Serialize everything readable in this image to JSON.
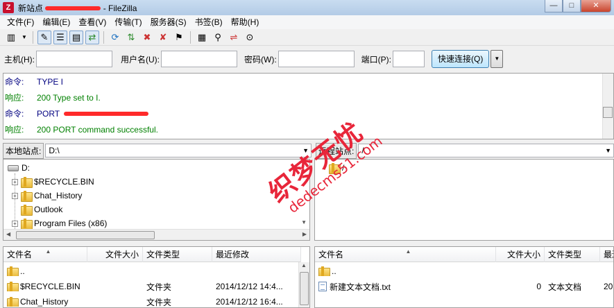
{
  "window": {
    "title": "新站点",
    "app": "FileZilla",
    "app_icon": "filezilla-icon",
    "controls": {
      "minimize": "—",
      "maximize": "□",
      "close": "✕"
    }
  },
  "menu": [
    "文件(F)",
    "编辑(E)",
    "查看(V)",
    "传输(T)",
    "服务器(S)",
    "书签(B)",
    "帮助(H)"
  ],
  "toolbar": {
    "icons": [
      "site-manager-icon",
      "dropdown-arrow-icon",
      "toggle-log-icon",
      "toggle-tree-icon",
      "toggle-remote-tree-icon",
      "toggle-queue-icon",
      "refresh-icon",
      "process-queue-icon",
      "cancel-icon",
      "disconnect-icon",
      "reconnect-icon",
      "filter-icon",
      "compare-icon",
      "sync-browse-icon",
      "search-icon"
    ]
  },
  "quickconnect": {
    "host_label": "主机(H):",
    "user_label": "用户名(U):",
    "pass_label": "密码(W):",
    "port_label": "端口(P):",
    "host_value": "",
    "user_value": "",
    "pass_value": "",
    "port_value": "",
    "button": "快速连接(Q)",
    "dropdown": "▼"
  },
  "log": [
    {
      "label": "命令:",
      "kind": "cmd",
      "msg": "TYPE I"
    },
    {
      "label": "响应:",
      "kind": "resp",
      "msg": "200 Type set to I."
    },
    {
      "label": "命令:",
      "kind": "cmd",
      "msg": "PORT"
    },
    {
      "label": "响应:",
      "kind": "resp",
      "msg": "200 PORT command successful."
    }
  ],
  "local": {
    "site_label": "本地站点:",
    "path": "D:\\",
    "tree_root": "D:",
    "tree": [
      {
        "name": "$RECYCLE.BIN",
        "expandable": true
      },
      {
        "name": "Chat_History",
        "expandable": true
      },
      {
        "name": "Outlook",
        "expandable": false
      },
      {
        "name": "Program Files (x86)",
        "expandable": true
      }
    ],
    "columns": [
      "文件名",
      "文件大小",
      "文件类型",
      "最近修改"
    ],
    "files": [
      {
        "name": "..",
        "size": "",
        "type": "",
        "modified": ""
      },
      {
        "name": "$RECYCLE.BIN",
        "size": "",
        "type": "文件夹",
        "modified": "2014/12/12 14:4..."
      },
      {
        "name": "Chat_History",
        "size": "",
        "type": "文件夹",
        "modified": "2014/12/12 16:4..."
      }
    ]
  },
  "remote": {
    "site_label": "远程站点:",
    "path": "/",
    "tree_root": "/",
    "columns": [
      "文件名",
      "文件大小",
      "文件类型",
      "最近修改"
    ],
    "files": [
      {
        "name": "..",
        "size": "",
        "type": "",
        "modified": ""
      },
      {
        "name": "新建文本文档.txt",
        "size": "0",
        "type": "文本文档",
        "modified": "20"
      }
    ]
  },
  "watermark": {
    "cn": "织梦无忧",
    "en": "dedecms51.com"
  }
}
